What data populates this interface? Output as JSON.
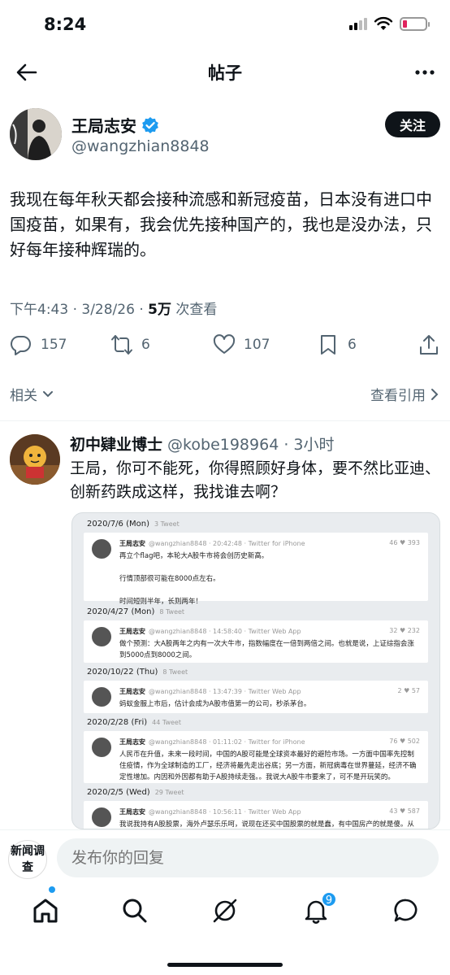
{
  "status_bar": {
    "time": "8:24"
  },
  "nav": {
    "title": "帖子"
  },
  "author": {
    "name": "王局志安",
    "handle": "@wangzhian8848",
    "follow_label": "关注"
  },
  "tweet": {
    "text": "我现在每年秋天都会接种流感和新冠疫苗，日本没有进口中国疫苗，如果有，我会优先接种国产的，我也是没办法，只好每年接种辉瑞的。",
    "time": "下午4:43 · 3/28/26 · ",
    "views_count": "5万",
    "views_label": " 次查看"
  },
  "actions": {
    "replies": "157",
    "retweets": "6",
    "likes": "107",
    "bookmarks": "6"
  },
  "related": {
    "label": "相关",
    "quotes_label": "查看引用"
  },
  "reply": {
    "name": "初中肄业博士",
    "handle": " @kobe198964 · 3小时",
    "text": "王局，你可不能死，你得照顾好身体，要不然比亚迪、创新药跌成这样，我找谁去啊？"
  },
  "embed": {
    "days": [
      {
        "date": "2020/7/6 (Mon)",
        "count": "3 Tweet"
      },
      {
        "date": "2020/4/27 (Mon)",
        "count": "8 Tweet"
      },
      {
        "date": "2020/10/22 (Thu)",
        "count": "8 Tweet"
      },
      {
        "date": "2020/2/28 (Fri)",
        "count": "44 Tweet"
      },
      {
        "date": "2020/2/5 (Wed)",
        "count": "29 Tweet"
      }
    ],
    "cards": [
      {
        "name": "王局志安",
        "meta": "@wangzhian8848 · 20:42:48 · Twitter for iPhone",
        "stats": "46 ♥ 393",
        "text": "再立个flag吧，本轮大A股牛市将会创历史新高。\n\n行情顶部很可能在8000点左右。\n\n时间短则半年，长则两年！"
      },
      {
        "name": "王局志安",
        "meta": "@wangzhian8848 · 14:58:40 · Twitter Web App",
        "stats": "32 ♥ 232",
        "text": "做个预测：大A股两年之内有一次大牛市，指数幅度在一倍到两倍之间。也就是说，上证综指会涨到5000点到8000之间。"
      },
      {
        "name": "王局志安",
        "meta": "@wangzhian8848 · 13:47:39 · Twitter Web App",
        "stats": "2 ♥ 57",
        "text": "蚂蚁金服上市后，估计会成为A股市值第一的公司，秒杀茅台。"
      },
      {
        "name": "王局志安",
        "meta": "@wangzhian8848 · 01:11:02 · Twitter for iPhone",
        "stats": "76 ♥ 502",
        "text": "人民币在升值，未来一段时间，中国的A股可能是全球资本最好的避险市场。一方面中国率先控制住疫情，作为全球制造的工厂，经济将最先走出谷底；另一方面，新冠病毒在世界蔓延，经济不确定性增加。内因和外因都有助于A股持续走强。。我说大A股牛市要来了，可不是开玩笑的。"
      },
      {
        "name": "王局志安",
        "meta": "@wangzhian8848 · 10:56:11 · Twitter Web App",
        "stats": "43 ♥ 587",
        "text": "我说我持有A股股票，海外卢瑟乐乐呵，说现在还买中国股票的就是蠢，有中国房产的就是傻。从个体来看，中国股票，喜是喜欢中国，是我的本钱，你说喜欢还买吗？你说喜欢那就买，你"
      }
    ]
  },
  "composer": {
    "avatar_text": "新闻调查",
    "placeholder": "发布你的回复"
  },
  "tabbar": {
    "notifications_badge": "9"
  }
}
